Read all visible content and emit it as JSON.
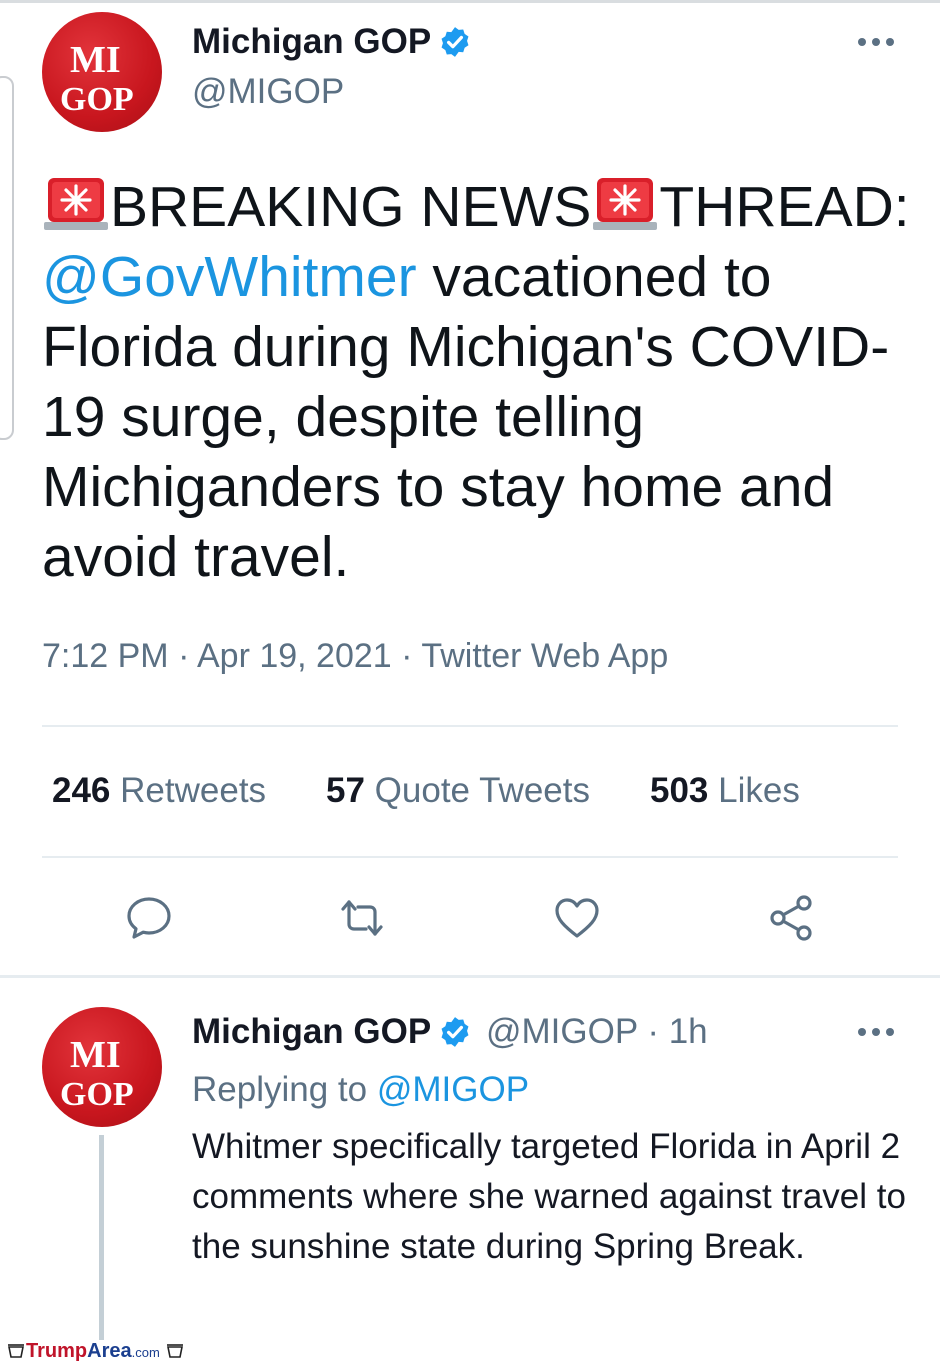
{
  "tweet": {
    "author_name": "Michigan GOP",
    "author_handle": "@MIGOP",
    "avatar_text_line1": "MI",
    "avatar_text_line2": "GOP",
    "text_part1": "BREAKING NEWS",
    "text_part2": "THREAD:",
    "mention": "@GovWhitmer",
    "text_part3": "vacationed to Florida during Michigan's COVID-19 surge, despite telling Michiganders to stay home and avoid travel.",
    "time": "7:12 PM",
    "date": "Apr 19, 2021",
    "source": "Twitter Web App",
    "separator": "·"
  },
  "stats": {
    "retweets_count": "246",
    "retweets_label": "Retweets",
    "quotes_count": "57",
    "quotes_label": "Quote Tweets",
    "likes_count": "503",
    "likes_label": "Likes"
  },
  "actions": [
    "reply-icon",
    "retweet-icon",
    "like-icon",
    "share-icon"
  ],
  "reply": {
    "author_name": "Michigan GOP",
    "author_handle": "@MIGOP",
    "time_ago": "1h",
    "separator": "·",
    "replying_prefix": "Replying to",
    "replying_to": "@MIGOP",
    "text": "Whitmer specifically targeted Florida in April 2 comments where she warned against travel to the sunshine state during Spring Break."
  },
  "watermark": {
    "part1": "Trump",
    "part2": "Area",
    "part3": ".com"
  },
  "colors": {
    "accent": "#1b95e0",
    "brand_red": "#c8161e",
    "secondary_text": "#5b7083",
    "verified": "#1d9bf0"
  }
}
